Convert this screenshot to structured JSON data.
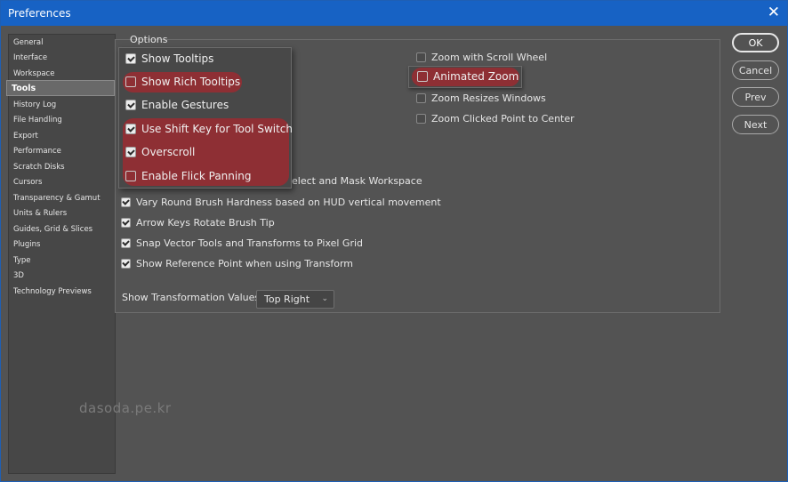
{
  "window": {
    "title": "Preferences"
  },
  "sidebar": {
    "items": [
      {
        "label": "General"
      },
      {
        "label": "Interface"
      },
      {
        "label": "Workspace"
      },
      {
        "label": "Tools"
      },
      {
        "label": "History Log"
      },
      {
        "label": "File Handling"
      },
      {
        "label": "Export"
      },
      {
        "label": "Performance"
      },
      {
        "label": "Scratch Disks"
      },
      {
        "label": "Cursors"
      },
      {
        "label": "Transparency & Gamut"
      },
      {
        "label": "Units & Rulers"
      },
      {
        "label": "Guides, Grid & Slices"
      },
      {
        "label": "Plugins"
      },
      {
        "label": "Type"
      },
      {
        "label": "3D"
      },
      {
        "label": "Technology Previews"
      }
    ],
    "active": "Tools"
  },
  "options": {
    "title": "Options",
    "popup_items": [
      {
        "label": "Show Tooltips",
        "checked": true,
        "highlighted": false
      },
      {
        "label": "Show Rich Tooltips",
        "checked": false,
        "highlighted": true
      },
      {
        "label": "Enable Gestures",
        "checked": true,
        "highlighted": false
      },
      {
        "label": "Use Shift Key for Tool Switch",
        "checked": true,
        "highlighted": true
      },
      {
        "label": "Overscroll",
        "checked": true,
        "highlighted": true
      },
      {
        "label": "Enable Flick Panning",
        "checked": false,
        "highlighted": true
      }
    ],
    "right_items": [
      {
        "label": "Zoom with Scroll Wheel",
        "checked": false
      },
      {
        "label": "Animated Zoom",
        "checked": false,
        "highlighted": true
      },
      {
        "label": "Zoom Resizes Windows",
        "checked": false
      },
      {
        "label": "Zoom Clicked Point to Center",
        "checked": false
      }
    ],
    "partial_item_tail": "elect and Mask Workspace",
    "lower_items": [
      {
        "label": "Vary Round Brush Hardness based on HUD vertical movement",
        "checked": true
      },
      {
        "label": "Arrow Keys Rotate Brush Tip",
        "checked": true
      },
      {
        "label": "Snap Vector Tools and Transforms to Pixel Grid",
        "checked": true
      },
      {
        "label": "Show Reference Point when using Transform",
        "checked": true
      }
    ],
    "transform_label": "Show Transformation Values:",
    "transform_value": "Top Right"
  },
  "buttons": {
    "ok": "OK",
    "cancel": "Cancel",
    "prev": "Prev",
    "next": "Next"
  },
  "watermark": "dasoda.pe.kr",
  "colors": {
    "title_bar": "#1762c4",
    "highlight": "#8e2f34",
    "background": "#535353"
  }
}
